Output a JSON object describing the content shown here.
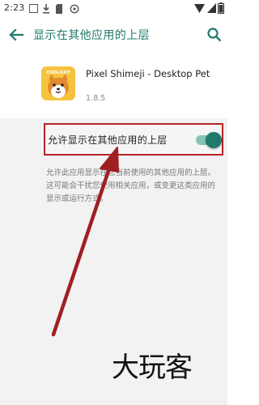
{
  "status_bar": {
    "time": "2:23"
  },
  "app_bar": {
    "title": "显示在其他应用的上层",
    "back_icon": "arrow-back-icon",
    "search_icon": "search-icon"
  },
  "app": {
    "name": "Pixel Shimeji - Desktop Pet",
    "version": "1.8.5",
    "icon_badge": "COOLGUY",
    "icon_name": "shiba-dog-app-icon"
  },
  "setting": {
    "label": "允许显示在其他应用的上层",
    "enabled": true
  },
  "description": "允许此应用显示在您当前使用的其他应用的上层。这可能会干扰您使用相关应用，或变更这类应用的显示或运行方式。",
  "watermark": "大玩客",
  "colors": {
    "accent": "#1f7a6c",
    "highlight_box": "#b52427",
    "arrow": "#9f1f22",
    "background": "#f2f2f2"
  }
}
